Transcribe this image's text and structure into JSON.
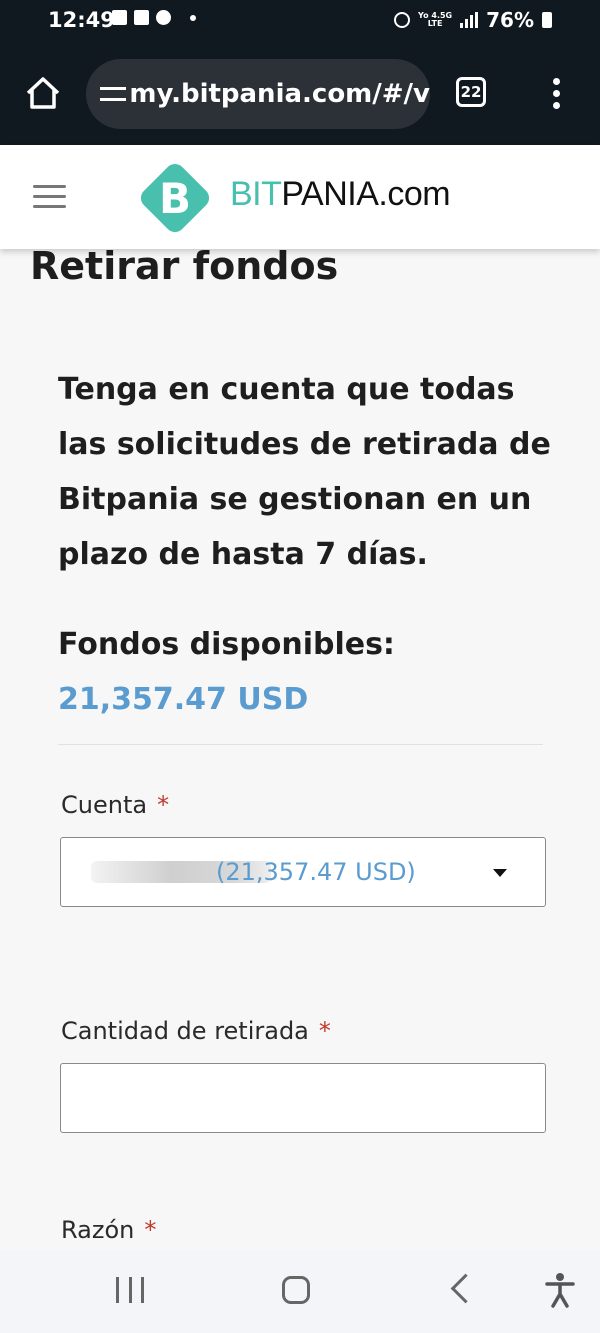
{
  "status_bar": {
    "time": "12:49",
    "network_top": "Yo",
    "network_type": "4.5G",
    "network_sub": "LTE",
    "battery": "76%"
  },
  "browser": {
    "url": "my.bitpania.com/#/v",
    "tab_count": "22"
  },
  "site": {
    "logo_bit": "BIT",
    "logo_rest": "PANIA.com",
    "logo_letter": "B",
    "brand_color": "#49bfae"
  },
  "page": {
    "title": "Retirar fondos",
    "notice": "Tenga en cuenta que todas las solicitudes de retirada de Bitpania se gestionan en un plazo de hasta 7 días.",
    "funds_label": "Fondos disponibles:",
    "funds_value": "21,357.47 USD",
    "accent_color": "#5a9bd0"
  },
  "form": {
    "account_label": "Cuenta",
    "account_value": "(21,357.47 USD)",
    "amount_label": "Cantidad de retirada",
    "amount_value": "",
    "reason_label": "Razón",
    "required_mark": "*"
  }
}
